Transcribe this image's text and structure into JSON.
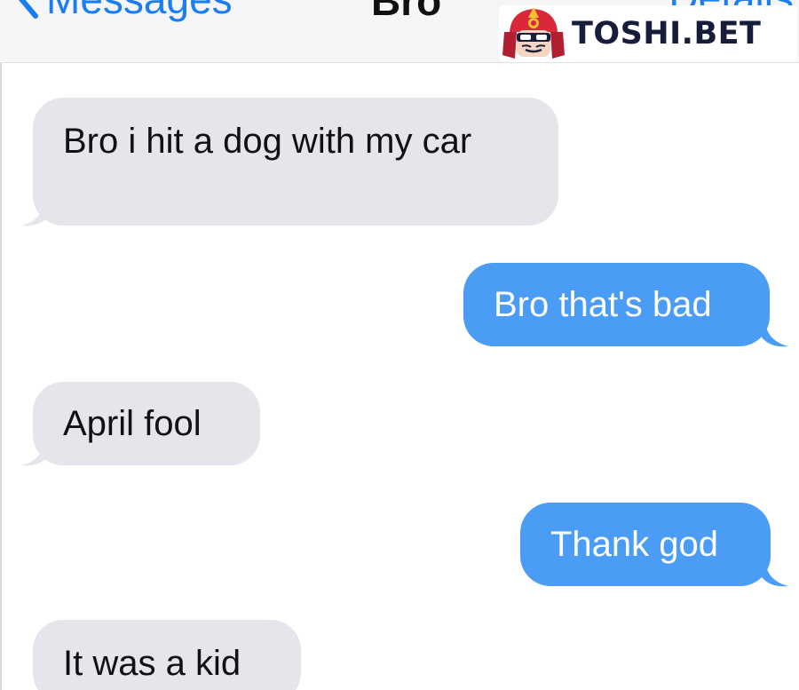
{
  "header": {
    "back_label": "Messages",
    "title": "Bro",
    "details_label": "Details"
  },
  "watermark": {
    "brand": "TOSHI.BET"
  },
  "messages": [
    {
      "direction": "incoming",
      "text": "Bro i hit a dog with my car"
    },
    {
      "direction": "outgoing",
      "text": "Bro that's bad"
    },
    {
      "direction": "incoming",
      "text": "April fool"
    },
    {
      "direction": "outgoing",
      "text": "Thank god"
    },
    {
      "direction": "incoming",
      "text": "It was a kid"
    }
  ],
  "colors": {
    "accent": "#1a7df2",
    "incoming_bubble": "#e6e5eb",
    "outgoing_bubble": "#4b9cf5",
    "nav_background": "#f6f6f8"
  },
  "icons": {
    "back": "chevron-left-icon",
    "logo": "samurai-mascot-icon"
  }
}
